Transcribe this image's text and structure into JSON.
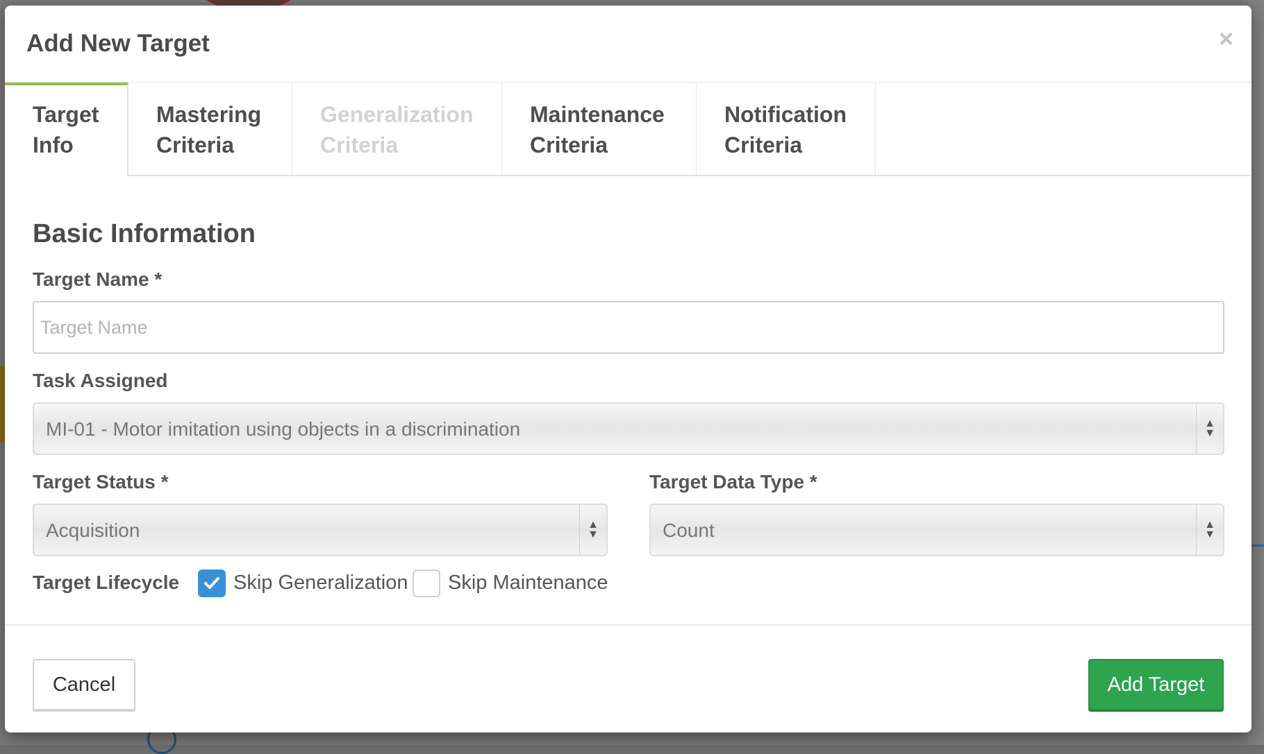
{
  "modal": {
    "title": "Add New Target",
    "close_label": "×"
  },
  "tabs": [
    {
      "line1": "Target",
      "line2": "Info",
      "state": "active"
    },
    {
      "line1": "Mastering",
      "line2": "Criteria",
      "state": "normal"
    },
    {
      "line1": "Generalization",
      "line2": "Criteria",
      "state": "disabled"
    },
    {
      "line1": "Maintenance",
      "line2": "Criteria",
      "state": "normal"
    },
    {
      "line1": "Notification",
      "line2": "Criteria",
      "state": "normal"
    }
  ],
  "form": {
    "section_title": "Basic Information",
    "target_name": {
      "label": "Target Name *",
      "placeholder": "Target Name",
      "value": ""
    },
    "task_assigned": {
      "label": "Task Assigned",
      "value": "MI-01 - Motor imitation using objects in a discrimination"
    },
    "target_status": {
      "label": "Target Status *",
      "value": "Acquisition"
    },
    "target_data_type": {
      "label": "Target Data Type *",
      "value": "Count"
    },
    "lifecycle": {
      "label": "Target Lifecycle",
      "skip_generalization": {
        "label": "Skip Generalization",
        "checked": true
      },
      "skip_maintenance": {
        "label": "Skip Maintenance",
        "checked": false
      }
    }
  },
  "footer": {
    "cancel_label": "Cancel",
    "add_label": "Add Target"
  },
  "colors": {
    "active_tab_accent": "#8cc152",
    "checkbox_checked": "#3a90d6",
    "primary_button": "#2ea44f"
  }
}
